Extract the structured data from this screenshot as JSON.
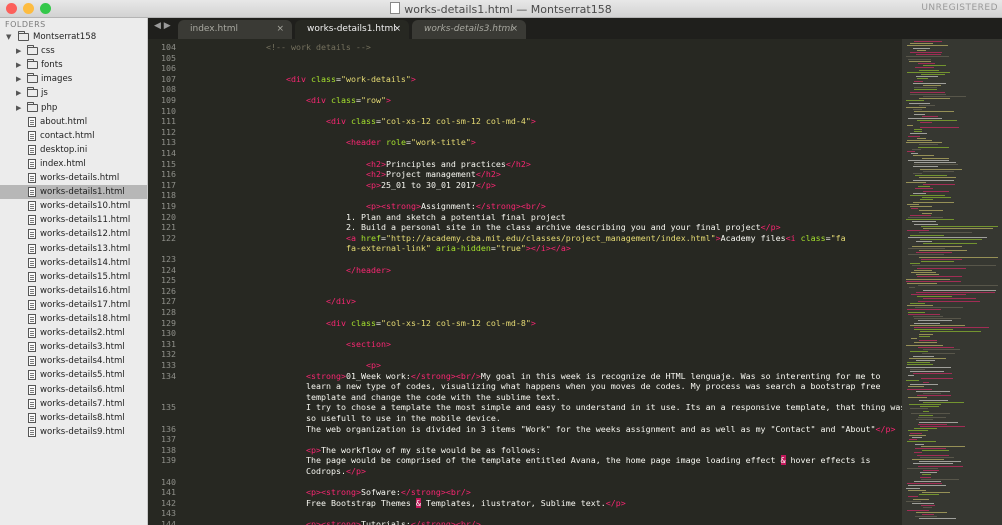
{
  "window": {
    "title": "works-details1.html — Montserrat158",
    "license_label": "UNREGISTERED",
    "traffic_colors": {
      "close": "#fc605b",
      "minimize": "#fdbc40",
      "zoom": "#34c84a"
    }
  },
  "sidebar": {
    "heading": "FOLDERS",
    "root": "Montserrat158",
    "folders": [
      "css",
      "fonts",
      "images",
      "js",
      "php"
    ],
    "files": [
      "about.html",
      "contact.html",
      "desktop.ini",
      "index.html",
      "works-details.html",
      "works-details1.html",
      "works-details10.html",
      "works-details11.html",
      "works-details12.html",
      "works-details13.html",
      "works-details14.html",
      "works-details15.html",
      "works-details16.html",
      "works-details17.html",
      "works-details18.html",
      "works-details2.html",
      "works-details3.html",
      "works-details4.html",
      "works-details5.html",
      "works-details6.html",
      "works-details7.html",
      "works-details8.html",
      "works-details9.html"
    ],
    "selected_file": "works-details1.html"
  },
  "tabs": [
    {
      "label": "index.html",
      "active": false
    },
    {
      "label": "works-details1.html",
      "active": true
    },
    {
      "label": "works-details3.html",
      "active": false
    }
  ],
  "tab_close_glyph": "×",
  "nav_glyphs": "◀ ▶",
  "theme": {
    "tag": "#f92672",
    "attr": "#a6e22e",
    "string": "#e6db74",
    "comment": "#75715e",
    "text": "#f8f8f2",
    "gutter": "#8f908a",
    "bg": "#272822"
  },
  "editor": {
    "rows": [
      {
        "n": "104",
        "t": [
          {
            "c": "cm",
            "x": "<!-- work details -->"
          }
        ]
      },
      {
        "n": "105",
        "t": []
      },
      {
        "n": "106",
        "t": []
      },
      {
        "n": "107",
        "t": [
          {
            "c": "tg",
            "x": "<div"
          },
          {
            "c": "at",
            "x": " class"
          },
          {
            "c": "",
            "x": "="
          },
          {
            "c": "sv",
            "x": "\"work-details\""
          },
          {
            "c": "tg",
            "x": ">"
          }
        ]
      },
      {
        "n": "108",
        "t": []
      },
      {
        "n": "109",
        "t": [
          {
            "c": "tg",
            "x": "<div"
          },
          {
            "c": "at",
            "x": " class"
          },
          {
            "c": "",
            "x": "="
          },
          {
            "c": "sv",
            "x": "\"row\""
          },
          {
            "c": "tg",
            "x": ">"
          }
        ]
      },
      {
        "n": "110",
        "t": []
      },
      {
        "n": "111",
        "t": [
          {
            "c": "tg",
            "x": "<div"
          },
          {
            "c": "at",
            "x": " class"
          },
          {
            "c": "",
            "x": "="
          },
          {
            "c": "sv",
            "x": "\"col-xs-12 col-sm-12 col-md-4\""
          },
          {
            "c": "tg",
            "x": ">"
          }
        ]
      },
      {
        "n": "112",
        "t": []
      },
      {
        "n": "113",
        "t": [
          {
            "c": "tg",
            "x": "<header"
          },
          {
            "c": "at",
            "x": " role"
          },
          {
            "c": "",
            "x": "="
          },
          {
            "c": "sv",
            "x": "\"work-title\""
          },
          {
            "c": "tg",
            "x": ">"
          }
        ]
      },
      {
        "n": "114",
        "t": []
      },
      {
        "n": "115",
        "t": [
          {
            "c": "tg",
            "x": "<h2>"
          },
          {
            "c": "",
            "x": "Principles and practices"
          },
          {
            "c": "tg",
            "x": "</h2>"
          }
        ]
      },
      {
        "n": "116",
        "t": [
          {
            "c": "tg",
            "x": "<h2>"
          },
          {
            "c": "",
            "x": "Project management"
          },
          {
            "c": "tg",
            "x": "</h2>"
          }
        ]
      },
      {
        "n": "117",
        "t": [
          {
            "c": "tg",
            "x": "<p>"
          },
          {
            "c": "",
            "x": "25_01 to 30_01 2017"
          },
          {
            "c": "tg",
            "x": "</p>"
          }
        ]
      },
      {
        "n": "118",
        "t": []
      },
      {
        "n": "119",
        "t": [
          {
            "c": "tg",
            "x": "<p><strong>"
          },
          {
            "c": "",
            "x": "Assignment:"
          },
          {
            "c": "tg",
            "x": "</strong><br/>"
          }
        ]
      },
      {
        "n": "120",
        "t": [
          {
            "c": "",
            "x": "1. Plan and sketch a potential final project"
          }
        ]
      },
      {
        "n": "121",
        "t": [
          {
            "c": "",
            "x": "2. Build a personal site in the class archive describing you and your final project"
          },
          {
            "c": "tg",
            "x": "</p>"
          }
        ]
      },
      {
        "n": "122",
        "t": [
          {
            "c": "tg",
            "x": "<a"
          },
          {
            "c": "at",
            "x": " href"
          },
          {
            "c": "",
            "x": "="
          },
          {
            "c": "sv",
            "x": "\"http://academy.cba.mit.edu/classes/project_management/index.html\""
          },
          {
            "c": "tg",
            "x": ">"
          },
          {
            "c": "",
            "x": "Academy files"
          },
          {
            "c": "tg",
            "x": "<i"
          },
          {
            "c": "at",
            "x": " class"
          },
          {
            "c": "",
            "x": "="
          },
          {
            "c": "sv",
            "x": "\"fa"
          }
        ]
      },
      {
        "n": "",
        "t": [
          {
            "c": "sv",
            "x": "fa-external-link\""
          },
          {
            "c": "at",
            "x": " aria-hidden"
          },
          {
            "c": "",
            "x": "="
          },
          {
            "c": "sv",
            "x": "\"true\""
          },
          {
            "c": "tg",
            "x": "></i></a>"
          }
        ]
      },
      {
        "n": "123",
        "t": []
      },
      {
        "n": "124",
        "t": [
          {
            "c": "tg",
            "x": "</header>"
          }
        ]
      },
      {
        "n": "125",
        "t": []
      },
      {
        "n": "126",
        "t": []
      },
      {
        "n": "127",
        "t": [
          {
            "c": "tg",
            "x": "</div>"
          }
        ]
      },
      {
        "n": "128",
        "t": []
      },
      {
        "n": "129",
        "t": [
          {
            "c": "tg",
            "x": "<div"
          },
          {
            "c": "at",
            "x": " class"
          },
          {
            "c": "",
            "x": "="
          },
          {
            "c": "sv",
            "x": "\"col-xs-12 col-sm-12 col-md-8\""
          },
          {
            "c": "tg",
            "x": ">"
          }
        ]
      },
      {
        "n": "130",
        "t": []
      },
      {
        "n": "131",
        "t": [
          {
            "c": "tg",
            "x": "<section>"
          }
        ]
      },
      {
        "n": "132",
        "t": []
      },
      {
        "n": "133",
        "t": [
          {
            "c": "tg",
            "x": "<p>"
          }
        ]
      },
      {
        "n": "134",
        "t": [
          {
            "c": "tg",
            "x": "<strong>"
          },
          {
            "c": "",
            "x": "01_Week work:"
          },
          {
            "c": "tg",
            "x": "</strong><br/>"
          },
          {
            "c": "",
            "x": "My goal in this week is recognize de HTML lenguaje. Was so interenting for me to"
          }
        ]
      },
      {
        "n": "",
        "t": [
          {
            "c": "",
            "x": "learn a new type of codes, visualizing what happens when you moves de codes. My process was search a bootstrap free"
          }
        ]
      },
      {
        "n": "",
        "t": [
          {
            "c": "",
            "x": "template and change the code with the sublime text."
          }
        ]
      },
      {
        "n": "135",
        "t": [
          {
            "c": "",
            "x": "I try to chose a template the most simple and easy to understand in it use. Its an a responsive template, that thing was"
          }
        ]
      },
      {
        "n": "",
        "t": [
          {
            "c": "",
            "x": "so usefull to use in the mobile device."
          }
        ]
      },
      {
        "n": "136",
        "t": [
          {
            "c": "",
            "x": "The web organization is divided in 3 items \"Work\" for the weeks assignment and as well as my \"Contact\" and \"About\""
          },
          {
            "c": "tg",
            "x": "</p>"
          }
        ]
      },
      {
        "n": "137",
        "t": []
      },
      {
        "n": "138",
        "t": [
          {
            "c": "tg",
            "x": "<p>"
          },
          {
            "c": "",
            "x": "The workflow of my site would be as follows:"
          }
        ]
      },
      {
        "n": "139",
        "t": [
          {
            "c": "",
            "x": "The page would be comprised of the template entitled Avana, the home page image loading effect "
          },
          {
            "c": "amp",
            "x": "&"
          },
          {
            "c": "",
            "x": " hover effects is"
          }
        ]
      },
      {
        "n": "",
        "t": [
          {
            "c": "",
            "x": "Codrops."
          },
          {
            "c": "tg",
            "x": "</p>"
          }
        ]
      },
      {
        "n": "140",
        "t": []
      },
      {
        "n": "141",
        "t": [
          {
            "c": "tg",
            "x": "<p><strong>"
          },
          {
            "c": "",
            "x": "Sofware:"
          },
          {
            "c": "tg",
            "x": "</strong><br/>"
          }
        ]
      },
      {
        "n": "142",
        "t": [
          {
            "c": "",
            "x": "Free Bootstrap Themes "
          },
          {
            "c": "amp",
            "x": "&"
          },
          {
            "c": "",
            "x": " Templates, ilustrator, Sublime text."
          },
          {
            "c": "tg",
            "x": "</p>"
          }
        ]
      },
      {
        "n": "143",
        "t": []
      },
      {
        "n": "144",
        "t": [
          {
            "c": "tg",
            "x": "<p><strong>"
          },
          {
            "c": "",
            "x": "Tutorials:"
          },
          {
            "c": "tg",
            "x": "</strong><br/>"
          }
        ]
      }
    ]
  }
}
